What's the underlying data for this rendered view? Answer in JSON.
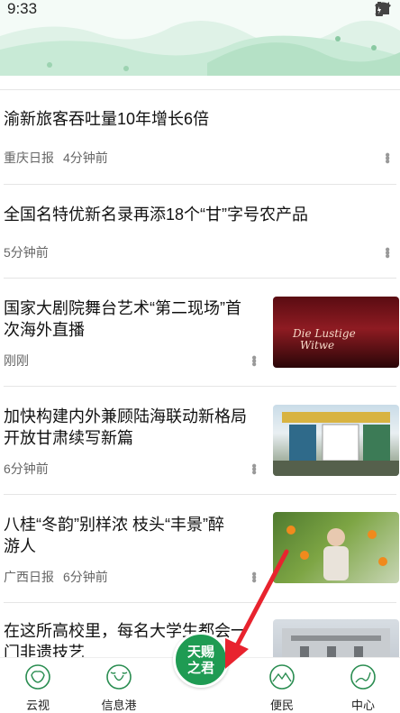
{
  "status_bar": {
    "time": "9:33"
  },
  "feed": {
    "items": [
      {
        "title": "渝新旅客吞吐量10年增长6倍",
        "source": "重庆日报",
        "time": "4分钟前"
      },
      {
        "title": "全国名特优新名录再添18个“甘”字号农产品",
        "source": "",
        "time": "5分钟前"
      },
      {
        "title_line1": "国家大剧院舞台艺术“第二现场”首",
        "title_line2": "次海外直播",
        "source": "",
        "time": "刚刚",
        "thumb_text": "Die Lustige Witwe"
      },
      {
        "title_line1": "加快构建内外兼顾陆海联动新格局",
        "title_line2": "开放甘肃续写新篇",
        "source": "",
        "time": "6分钟前"
      },
      {
        "title_line1": "八桂“冬韵”别样浓  枝头“丰景”醉",
        "title_line2": "游人",
        "source": "广西日报",
        "time": "6分钟前"
      },
      {
        "title_line1": "在这所高校里，每名大学生都会一",
        "title_line2": "门非遗技艺"
      }
    ]
  },
  "bottom_nav": {
    "items": [
      {
        "label": "云视",
        "icon": "sheep-icon"
      },
      {
        "label": "信息港",
        "icon": "ox-icon"
      },
      {
        "label": "便民",
        "icon": "mountain-icon"
      },
      {
        "label": "中心",
        "icon": "river-icon"
      }
    ],
    "center_label_line1": "天赐",
    "center_label_line2": "之君"
  },
  "colors": {
    "accent": "#1f9b53",
    "arrow": "#e8232e"
  }
}
